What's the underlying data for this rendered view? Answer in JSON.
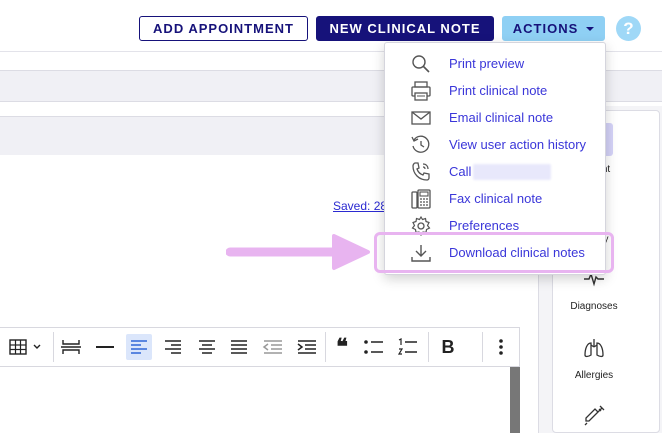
{
  "header": {
    "add_appointment": "ADD APPOINTMENT",
    "new_clinical_note": "NEW CLINICAL NOTE",
    "actions": "ACTIONS",
    "help": "?"
  },
  "actions_menu": {
    "items": [
      {
        "label": "Print preview",
        "icon": "search-icon"
      },
      {
        "label": "Print clinical note",
        "icon": "printer-icon"
      },
      {
        "label": "Email clinical note",
        "icon": "envelope-icon"
      },
      {
        "label": "View user action history",
        "icon": "history-icon"
      },
      {
        "label": "Call",
        "icon": "phone-icon"
      },
      {
        "label": "Fax clinical note",
        "icon": "fax-icon"
      },
      {
        "label": "Preferences",
        "icon": "gear-icon"
      },
      {
        "label": "Download clinical notes",
        "icon": "download-icon"
      }
    ]
  },
  "note": {
    "saved_label": "Saved: 28"
  },
  "sidebar": {
    "items": [
      {
        "label": "nt"
      },
      {
        "label": "y"
      },
      {
        "label": "Diagnoses",
        "icon": "heartbeat-icon"
      },
      {
        "label": "Allergies",
        "icon": "lungs-icon"
      },
      {
        "label": "",
        "icon": "syringe-icon"
      }
    ]
  },
  "toolbar": {
    "bold": "B",
    "quote": "❝"
  },
  "colors": {
    "brand_dark": "#16127a",
    "actions_bg": "#8fd0f4",
    "menu_link": "#3a36d9",
    "highlight": "#e8b4f0"
  }
}
